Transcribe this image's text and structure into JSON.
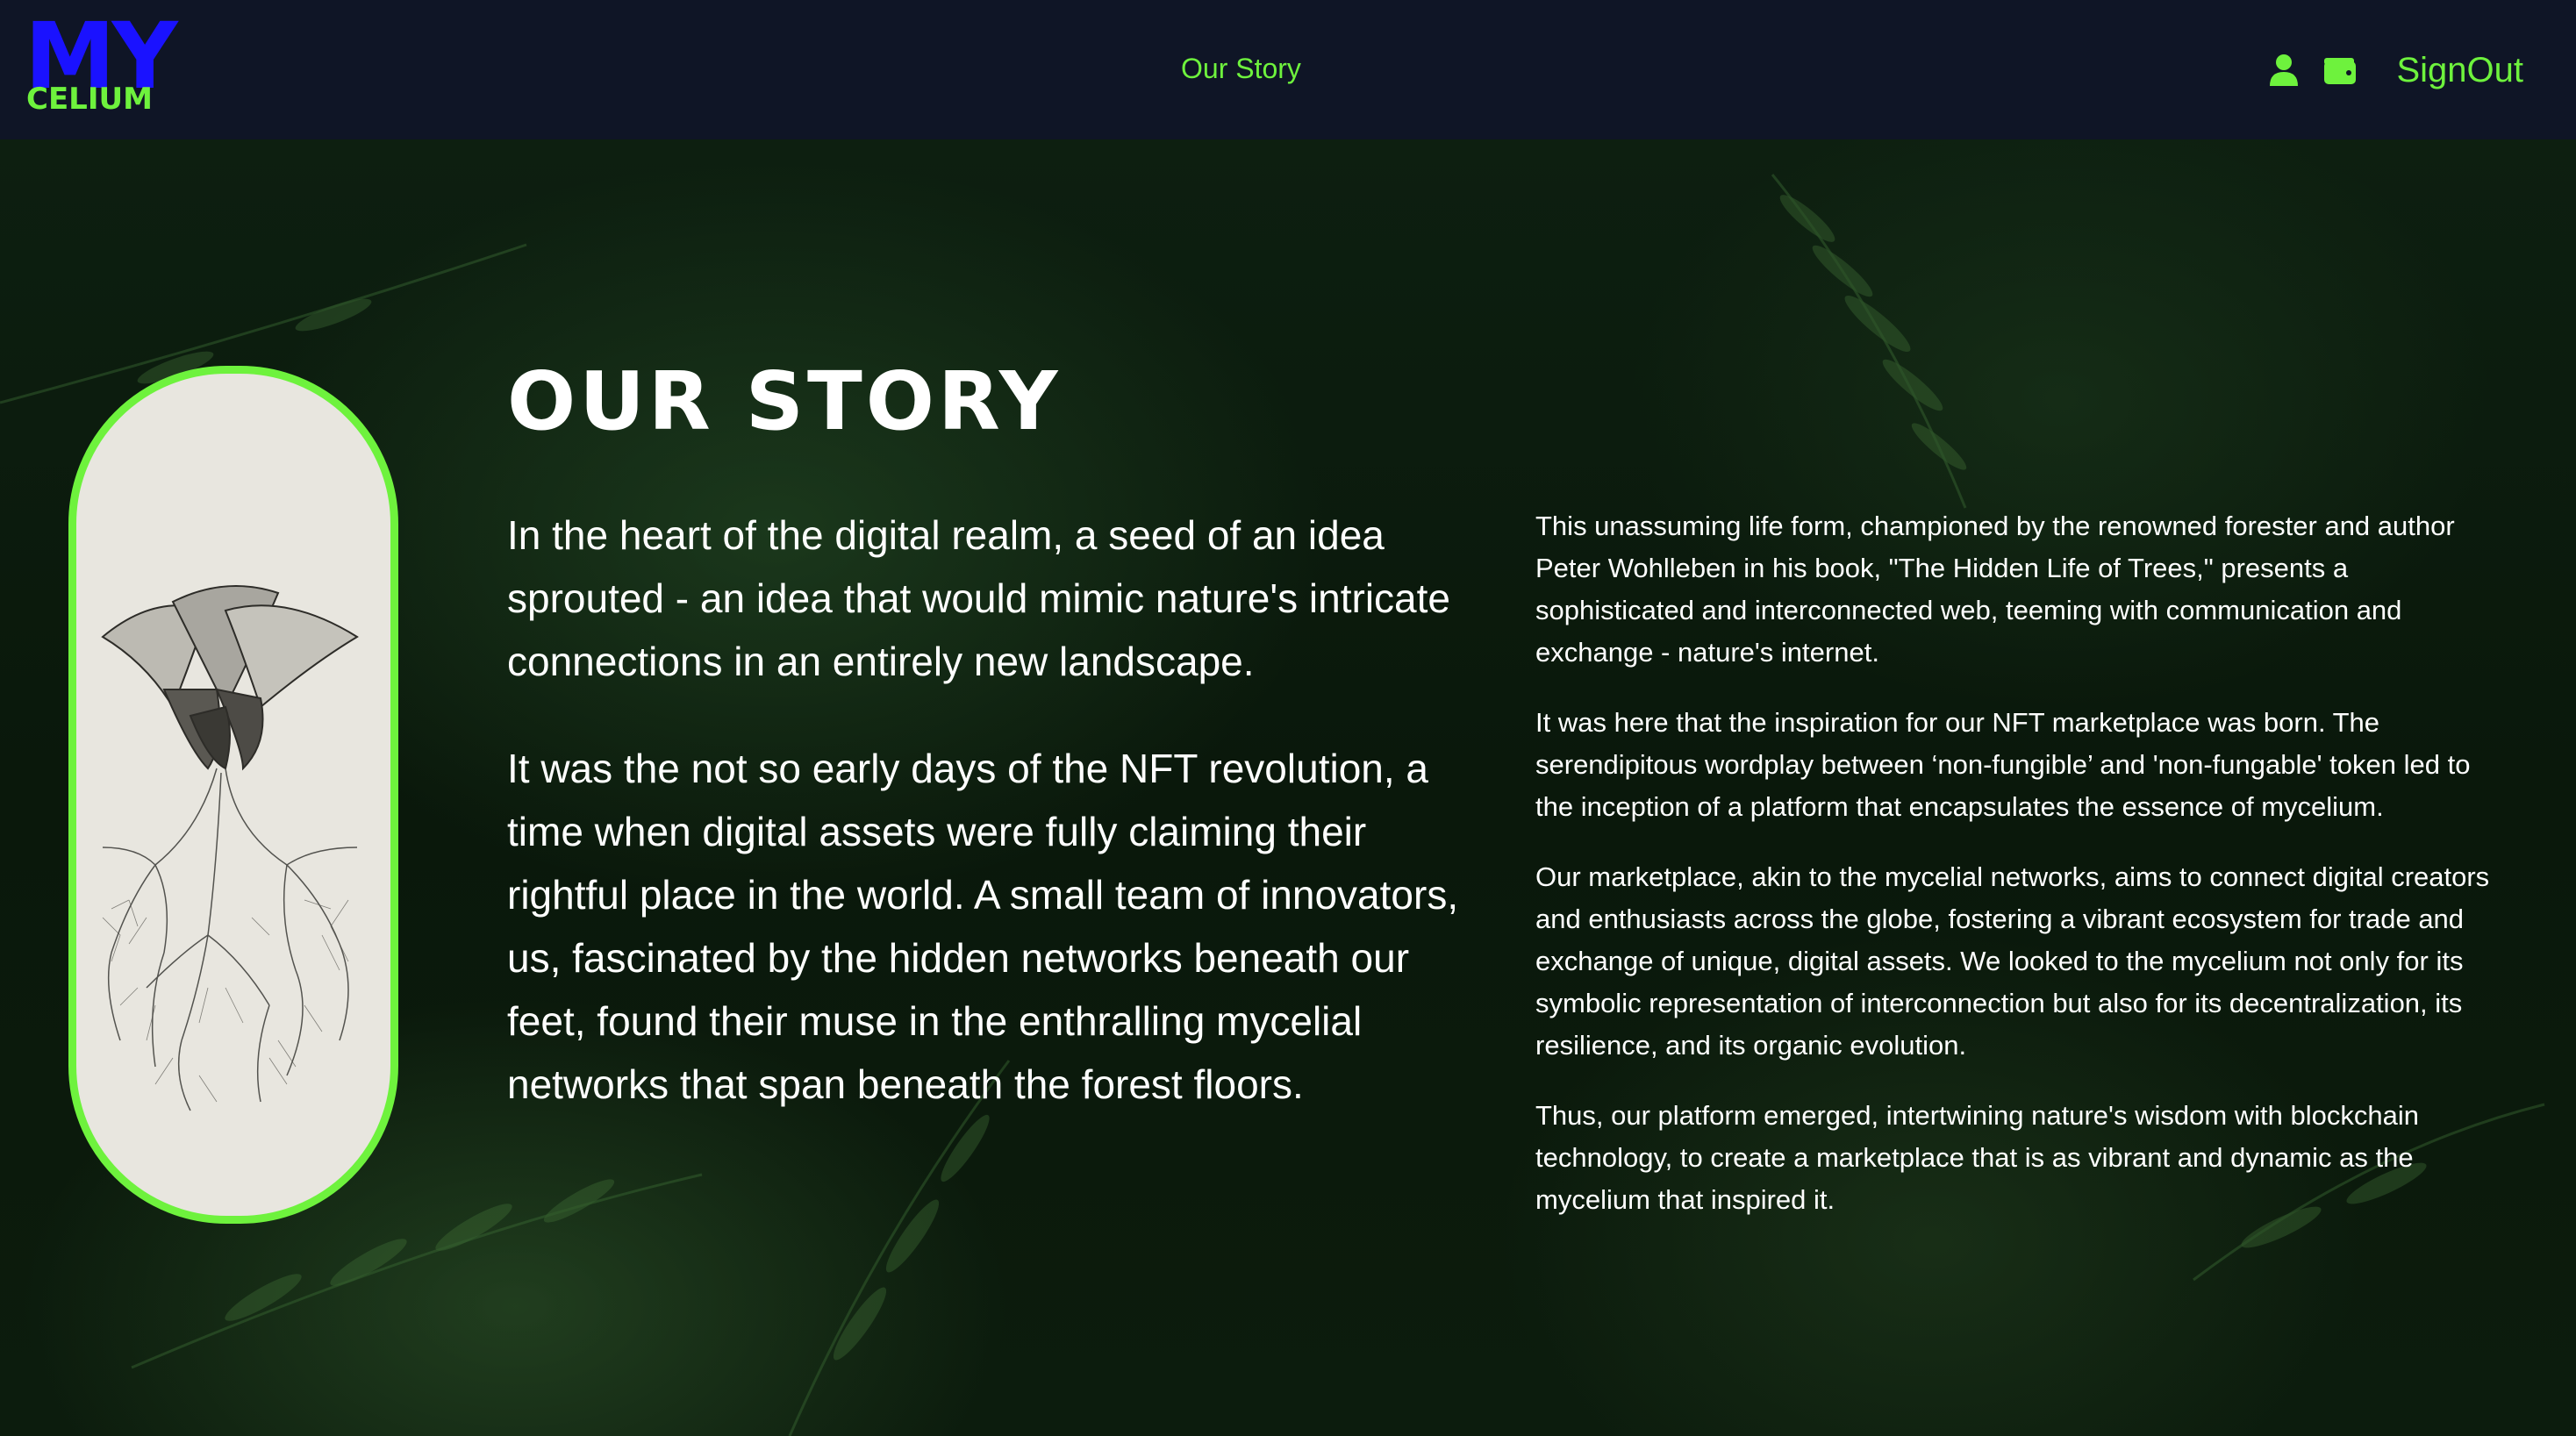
{
  "header": {
    "logo_top": "MY",
    "logo_bottom": "CELIUM",
    "nav_link": "Our Story",
    "user_icon": "user-icon",
    "wallet_icon": "wallet-icon",
    "signout_label": "SignOut"
  },
  "colors": {
    "header_bg": "#0f1526",
    "accent": "#6ef23d",
    "logo_blue": "#1a12ff",
    "text": "#ffffff",
    "card_bg": "#e8e6df"
  },
  "main": {
    "title": "OUR STORY",
    "left_paragraphs": [
      "In the heart of the digital realm, a seed of an idea sprouted - an idea that would mimic nature's intricate connections in an entirely new landscape.",
      "It was the not so early days of the NFT revolution, a time when digital assets were fully claiming their rightful place in the world. A small team of innovators, us, fascinated by the hidden networks beneath our feet, found their muse in the enthralling mycelial networks that span beneath the forest floors."
    ],
    "right_paragraphs": [
      "This unassuming life form, championed by the renowned forester and author Peter Wohlleben in his book, \"The Hidden Life of Trees,\" presents a sophisticated and interconnected web, teeming with communication and exchange - nature's internet.",
      "It was here that the inspiration for our NFT marketplace was born. The serendipitous wordplay between ‘non-fungible’ and 'non-fungable' token led to the inception of a platform that encapsulates the essence of mycelium.",
      "Our marketplace, akin to the mycelial networks, aims to connect digital creators and enthusiasts across the globe, fostering a vibrant ecosystem for trade and exchange of unique, digital assets. We looked to the mycelium not only for its symbolic representation of interconnection but also for its decentralization, its resilience, and its organic evolution.",
      "Thus, our platform emerged, intertwining nature's wisdom with blockchain technology, to create a marketplace that is as vibrant and dynamic as the mycelium that inspired it."
    ]
  }
}
